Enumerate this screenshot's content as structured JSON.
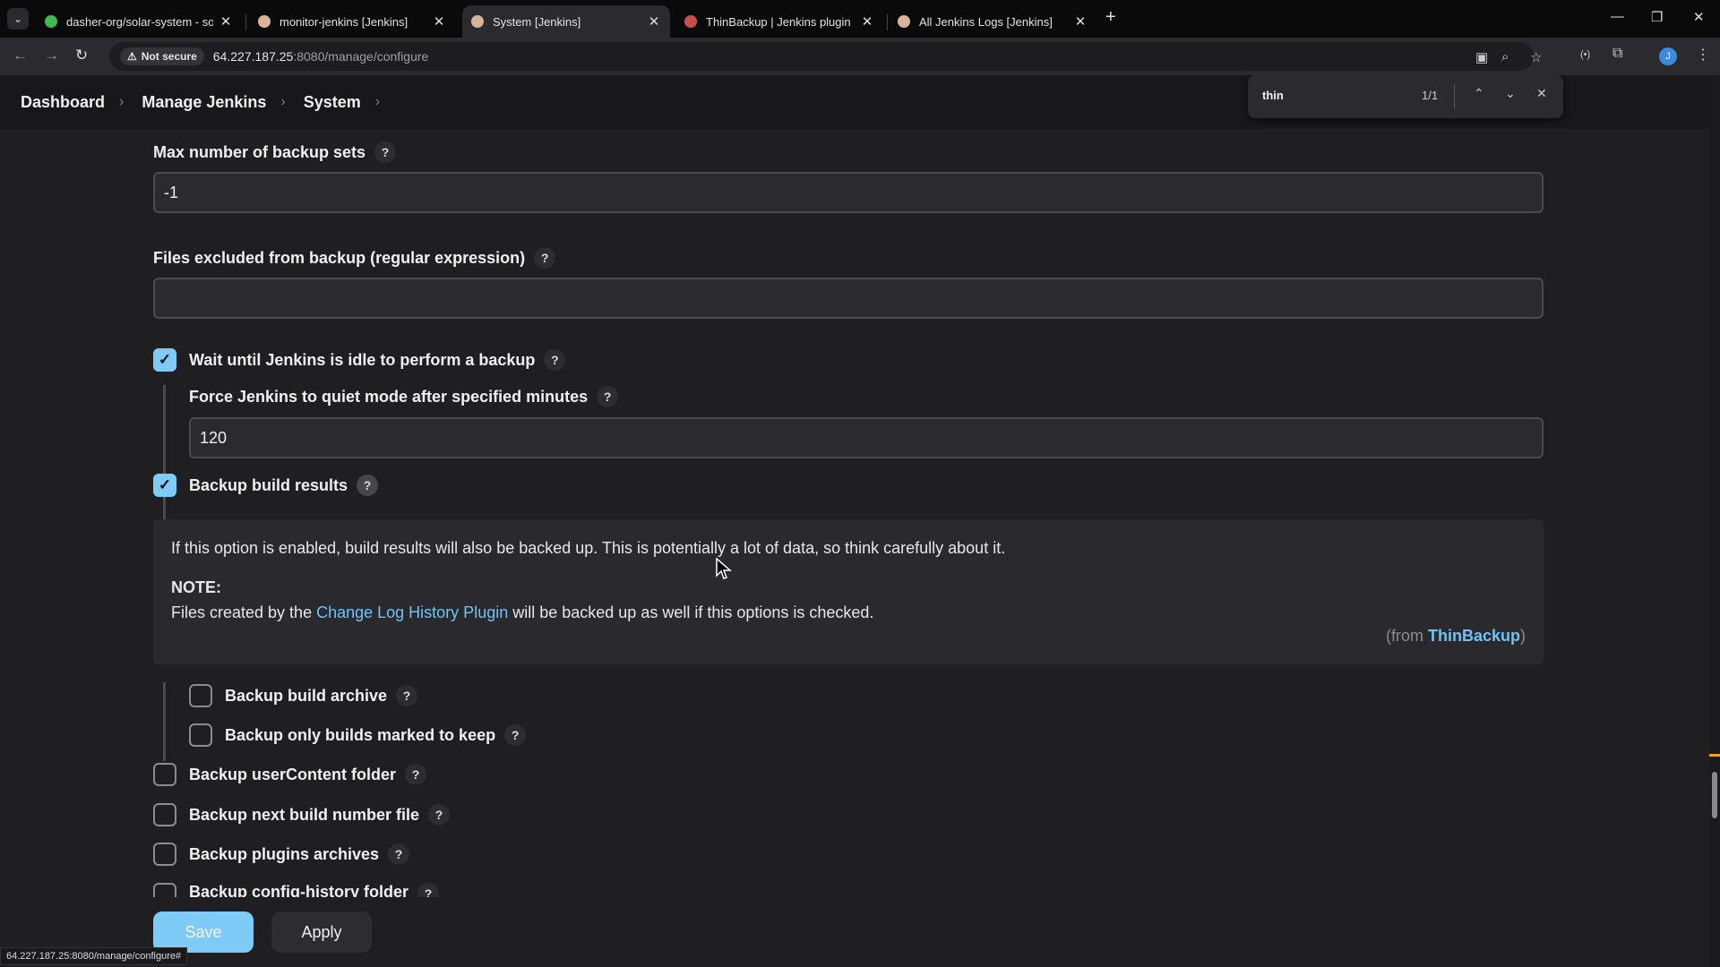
{
  "browser": {
    "tabs": [
      {
        "title": "dasher-org/solar-system - solar",
        "favicon_color": "#3fb950",
        "active": false
      },
      {
        "title": "monitor-jenkins [Jenkins]",
        "favicon_color": "#d9b39a",
        "active": false
      },
      {
        "title": "System [Jenkins]",
        "favicon_color": "#d9b39a",
        "active": true
      },
      {
        "title": "ThinBackup | Jenkins plugin",
        "favicon_color": "#c94f4f",
        "active": false
      },
      {
        "title": "All Jenkins Logs [Jenkins]",
        "favicon_color": "#d9b39a",
        "active": false
      }
    ],
    "security_label": "Not secure",
    "url_host": "64.227.187.25",
    "url_rest": ":8080/manage/configure",
    "find": {
      "query": "thin",
      "count": "1/1"
    },
    "profile_initial": "J",
    "status_url": "64.227.187.25:8080/manage/configure#"
  },
  "breadcrumb": [
    "Dashboard",
    "Manage Jenkins",
    "System"
  ],
  "form": {
    "max_backup_sets": {
      "label": "Max number of backup sets",
      "value": "-1"
    },
    "files_excluded": {
      "label": "Files excluded from backup (regular expression)",
      "value": ""
    },
    "wait_idle": {
      "label": "Wait until Jenkins is idle to perform a backup",
      "checked": true
    },
    "force_quiet": {
      "label": "Force Jenkins to quiet mode after specified minutes",
      "value": "120"
    },
    "backup_build_results": {
      "label": "Backup build results",
      "checked": true
    },
    "help": {
      "p1": "If this option is enabled, build results will also be backed up. This is potentially a lot of data, so think carefully about it.",
      "note": "NOTE:",
      "p2_before": "Files created by the ",
      "p2_link": "Change Log History Plugin",
      "p2_after": " will be backed up as well if this options is checked.",
      "from_prefix": "(from ",
      "from_link": "ThinBackup",
      "from_suffix": ")"
    },
    "backup_build_archive": {
      "label": "Backup build archive",
      "checked": false
    },
    "backup_only_keep": {
      "label": "Backup only builds marked to keep",
      "checked": false
    },
    "backup_usercontent": {
      "label": "Backup userContent folder",
      "checked": false
    },
    "backup_next_build": {
      "label": "Backup next build number file",
      "checked": false
    },
    "backup_plugins": {
      "label": "Backup plugins archives",
      "checked": false
    },
    "backup_config_history": {
      "label": "Backup config-history folder",
      "checked": false
    }
  },
  "buttons": {
    "save": "Save",
    "apply": "Apply"
  },
  "help_glyph": "?",
  "check_glyph": "✓"
}
